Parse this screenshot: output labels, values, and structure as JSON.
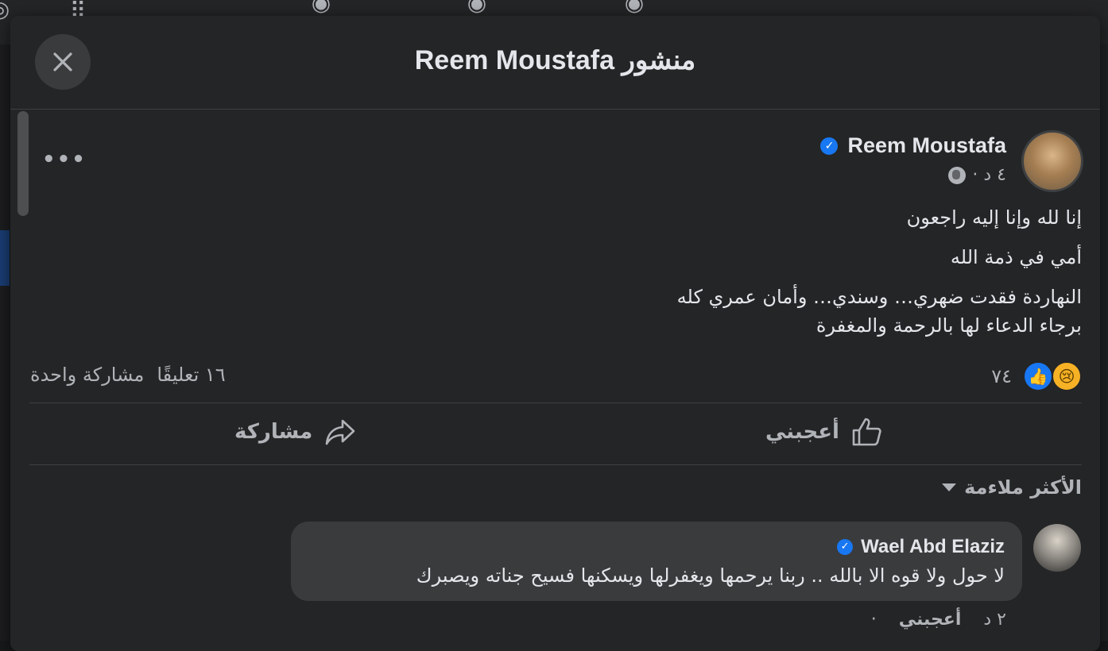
{
  "dialog": {
    "title": "منشور Reem Moustafa"
  },
  "post": {
    "author": "Reem Moustafa",
    "time": "٤ د ·",
    "lines": [
      "إنا لله وإنا إليه راجعون",
      "أمي في ذمة الله",
      "النهاردة فقدت ضهري… وسندي… وأمان عمري كله",
      "برجاء الدعاء لها بالرحمة والمغفرة"
    ],
    "reaction_count": "٧٤",
    "comments_count": "١٦ تعليقًا",
    "shares_count": "مشاركة واحدة"
  },
  "actions": {
    "like_label": "أعجبني",
    "share_label": "مشاركة"
  },
  "comments_section": {
    "sort_label": "الأكثر ملاءمة"
  },
  "comments": [
    {
      "author": "Wael Abd Elaziz",
      "text": "لا حول ولا قوه الا بالله .. ربنا يرحمها ويغفرلها ويسكنها فسيح جناته ويصبرك",
      "time": "٢ د",
      "like_label": "أعجبني"
    }
  ],
  "icons": {
    "close": "close-icon",
    "more": "more-options-icon",
    "verified": "verified-badge-icon",
    "globe": "globe-icon",
    "like": "thumbs-up-icon",
    "share": "share-arrow-icon",
    "sort": "caret-down-icon"
  },
  "colors": {
    "background": "#18191a",
    "dialog": "#242526",
    "bubble": "#3a3b3c",
    "text_primary": "#e4e6eb",
    "text_secondary": "#b0b3b8",
    "accent": "#1877f2"
  }
}
